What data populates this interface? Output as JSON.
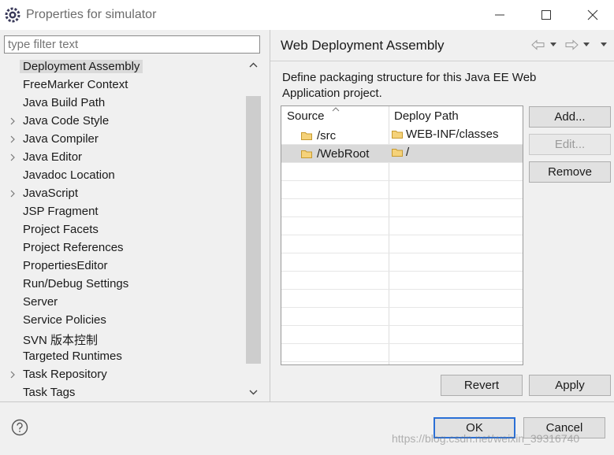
{
  "window": {
    "title": "Properties for simulator",
    "icon": "eclipse-gear-icon"
  },
  "filter": {
    "placeholder": "type filter text",
    "value": ""
  },
  "tree": {
    "items": [
      {
        "label": "Deployment Assembly",
        "expandable": false,
        "selected": true
      },
      {
        "label": "FreeMarker Context",
        "expandable": false
      },
      {
        "label": "Java Build Path",
        "expandable": false
      },
      {
        "label": "Java Code Style",
        "expandable": true
      },
      {
        "label": "Java Compiler",
        "expandable": true
      },
      {
        "label": "Java Editor",
        "expandable": true
      },
      {
        "label": "Javadoc Location",
        "expandable": false
      },
      {
        "label": "JavaScript",
        "expandable": true
      },
      {
        "label": "JSP Fragment",
        "expandable": false
      },
      {
        "label": "Project Facets",
        "expandable": false
      },
      {
        "label": "Project References",
        "expandable": false
      },
      {
        "label": "PropertiesEditor",
        "expandable": false
      },
      {
        "label": "Run/Debug Settings",
        "expandable": false
      },
      {
        "label": "Server",
        "expandable": false
      },
      {
        "label": "Service Policies",
        "expandable": false
      },
      {
        "label": "SVN 版本控制",
        "expandable": false
      },
      {
        "label": "Targeted Runtimes",
        "expandable": false
      },
      {
        "label": "Task Repository",
        "expandable": true
      },
      {
        "label": "Task Tags",
        "expandable": false
      }
    ]
  },
  "page": {
    "title": "Web Deployment Assembly",
    "description": "Define packaging structure for this Java EE Web Application project."
  },
  "table": {
    "headers": {
      "source": "Source",
      "deploy_path": "Deploy Path"
    },
    "rows": [
      {
        "source": "/src",
        "deploy_path": "WEB-INF/classes"
      },
      {
        "source": "/WebRoot",
        "deploy_path": "/"
      }
    ]
  },
  "buttons": {
    "add": "Add...",
    "edit": "Edit...",
    "remove": "Remove",
    "revert": "Revert",
    "apply": "Apply",
    "ok": "OK",
    "cancel": "Cancel"
  },
  "watermark": "https://blog.csdn.net/weixin_39316740",
  "colors": {
    "selection": "#d9d9d9",
    "default_button_border": "#2a6fd6",
    "folder": "#e8b64c"
  }
}
